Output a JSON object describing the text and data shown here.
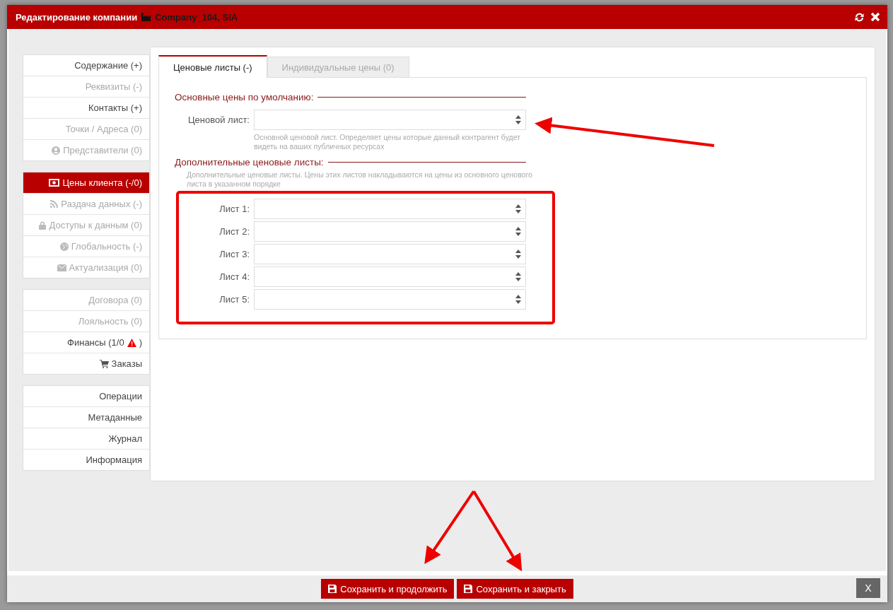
{
  "dialog": {
    "title": "Редактирование компании",
    "company": "Company_104, SIA"
  },
  "sidebar": {
    "groups": [
      [
        {
          "label": "Содержание (+)",
          "disabled": false,
          "selected": false
        },
        {
          "label": "Реквизиты (-)",
          "disabled": true,
          "selected": false
        },
        {
          "label": "Контакты (+)",
          "disabled": false,
          "selected": false
        },
        {
          "label": "Точки / Адреса (0)",
          "disabled": true,
          "selected": false
        },
        {
          "label": "Представители (0)",
          "disabled": true,
          "selected": false
        }
      ],
      [
        {
          "label": "Цены клиента (-/0)",
          "disabled": false,
          "selected": true
        },
        {
          "label": "Раздача данных (-)",
          "disabled": true,
          "selected": false
        },
        {
          "label": "Доступы к данным (0)",
          "disabled": true,
          "selected": false
        },
        {
          "label": "Глобальность (-)",
          "disabled": true,
          "selected": false
        },
        {
          "label": "Актуализация (0)",
          "disabled": true,
          "selected": false
        }
      ],
      [
        {
          "label": "Договора (0)",
          "disabled": true,
          "selected": false
        },
        {
          "label": "Лояльность (0)",
          "disabled": true,
          "selected": false
        },
        {
          "label": "Финансы (1/0",
          "warning": true,
          "after": ")",
          "disabled": false,
          "selected": false
        },
        {
          "label": "Заказы",
          "disabled": false,
          "selected": false
        }
      ],
      [
        {
          "label": "Операции",
          "disabled": false,
          "selected": false
        },
        {
          "label": "Метаданные",
          "disabled": false,
          "selected": false
        },
        {
          "label": "Журнал",
          "disabled": false,
          "selected": false
        },
        {
          "label": "Информация",
          "disabled": false,
          "selected": false
        }
      ]
    ]
  },
  "tabs": [
    {
      "label": "Ценовые листы (-)",
      "selected": true
    },
    {
      "label": "Индивидуальные цены (0)",
      "selected": false
    }
  ],
  "main_section": {
    "heading": "Основные цены по умолчанию:",
    "label": "Ценовой лист:",
    "help": "Основной ценовой лист. Определяет цены которые данный контрагент будет видеть на ваших публичных ресурсах"
  },
  "extra_section": {
    "heading": "Дополнительные ценовые листы:",
    "help": "Дополнительные ценовые листы. Цены этих листов накладываются на цены из основного ценового листа в указанном порядке",
    "fields": [
      {
        "label": "Лист 1:"
      },
      {
        "label": "Лист 2:"
      },
      {
        "label": "Лист 3:"
      },
      {
        "label": "Лист 4:"
      },
      {
        "label": "Лист 5:"
      }
    ]
  },
  "footer": {
    "buttons": [
      "Сохранить и продолжить",
      "Сохранить и закрыть"
    ],
    "close": "X"
  }
}
